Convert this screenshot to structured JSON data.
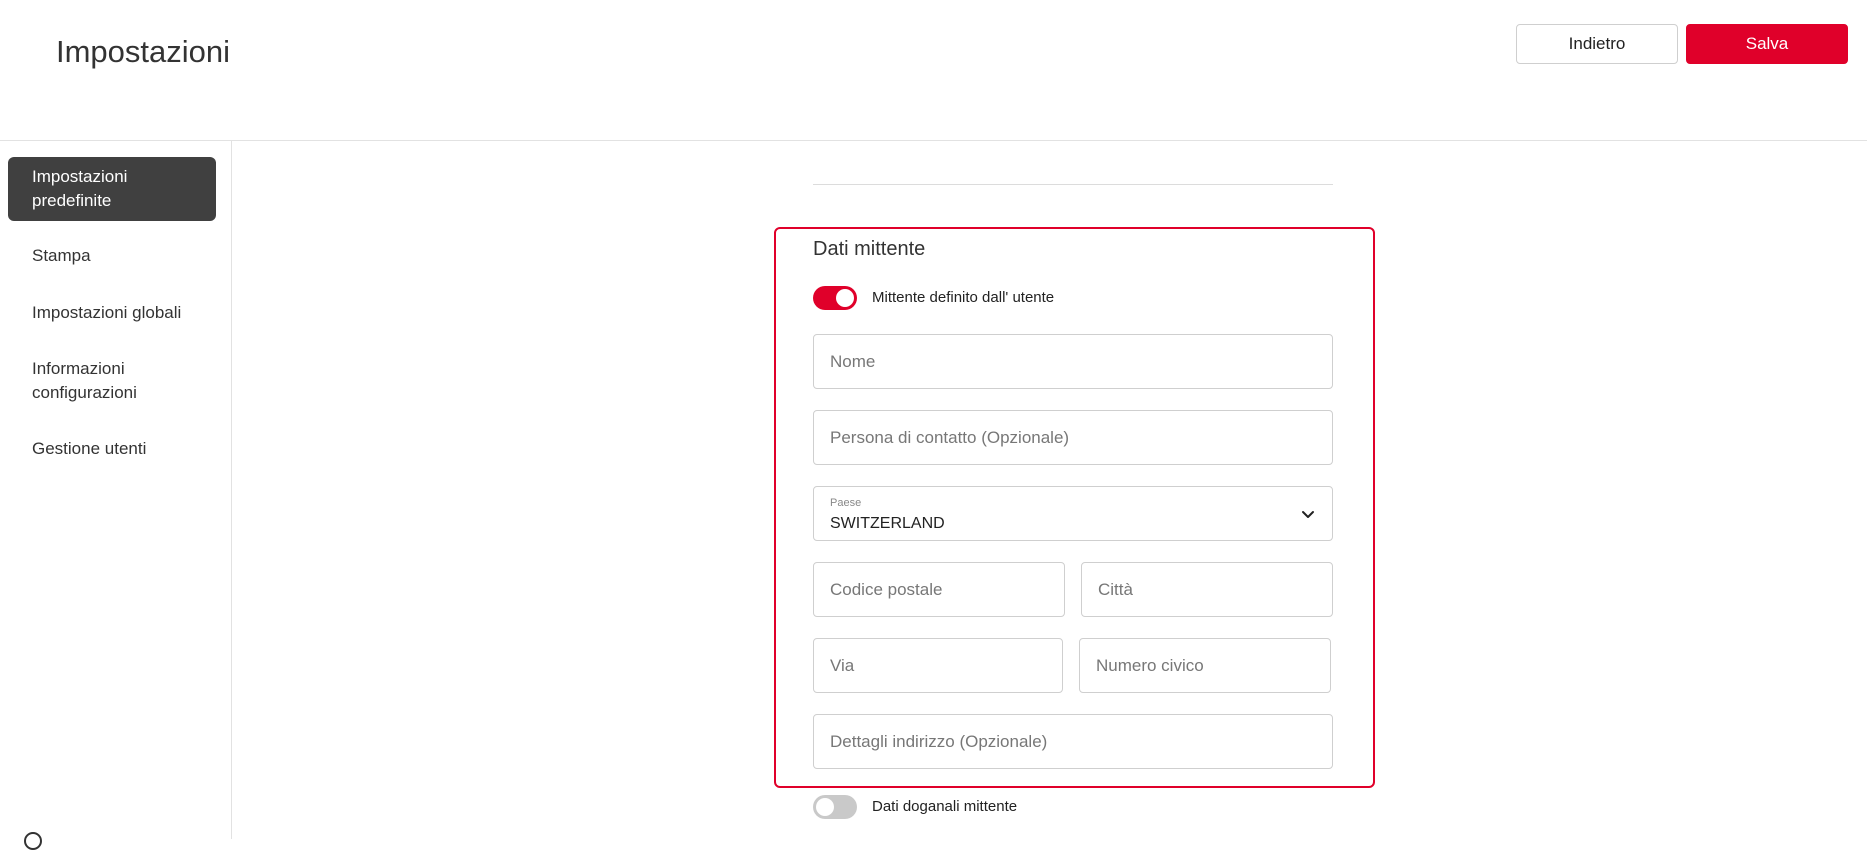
{
  "header": {
    "title": "Impostazioni",
    "back_label": "Indietro",
    "save_label": "Salva"
  },
  "sidebar": {
    "items": [
      {
        "label": "Impostazioni predefinite",
        "active": true
      },
      {
        "label": "Stampa"
      },
      {
        "label": "Impostazioni globali"
      },
      {
        "label": "Informazioni configurazioni"
      },
      {
        "label": "Gestione utenti"
      }
    ]
  },
  "sender": {
    "title": "Dati mittente",
    "user_defined_toggle": {
      "label": "Mittente definito dall' utente",
      "on": true
    },
    "name_placeholder": "Nome",
    "contact_placeholder": "Persona di contatto (Opzionale)",
    "country": {
      "label": "Paese",
      "value": "SWITZERLAND"
    },
    "postal_placeholder": "Codice postale",
    "city_placeholder": "Città",
    "street_placeholder": "Via",
    "number_placeholder": "Numero civico",
    "details_placeholder": "Dettagli indirizzo (Opzionale)"
  },
  "customs": {
    "toggle": {
      "label": "Dati doganali mittente",
      "on": false
    }
  },
  "colors": {
    "accent": "#e0002a",
    "sidebar_active": "#404040"
  }
}
